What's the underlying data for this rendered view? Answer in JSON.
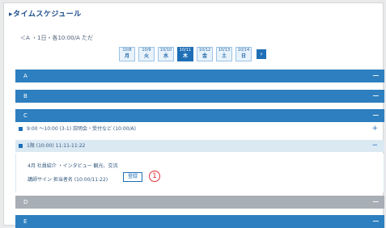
{
  "page": {
    "title": "▸タイムスケジュール",
    "subtitle": "＜A ・1日・各10:00/A ただ"
  },
  "days": [
    {
      "label": "10/8",
      "num": "月"
    },
    {
      "label": "10/9",
      "num": "火"
    },
    {
      "label": "10/10",
      "num": "水"
    },
    {
      "label": "10/11",
      "num": "木"
    },
    {
      "label": "10/12",
      "num": "金"
    },
    {
      "label": "10/13",
      "num": "土"
    },
    {
      "label": "10/14",
      "num": "日"
    }
  ],
  "nav": {
    "next": "›"
  },
  "sections": [
    {
      "label": "A",
      "sign": "−"
    },
    {
      "label": "B",
      "sign": "−"
    },
    {
      "label": "C",
      "sign": "−"
    }
  ],
  "items": [
    {
      "text": "9:00 〜10:00 (3-1) 説明会・受付など (10:00/A)",
      "sign": "+"
    },
    {
      "text": "1限 (10:00) 11:11-11:22",
      "sign": "−"
    }
  ],
  "detail": {
    "line1": "4月 社員紹介 ・インタビュー 観光、交流",
    "line2": "講師サイン 担当者名 (10:00/11:22)",
    "button_label": "登録",
    "marker": "1"
  },
  "sections_after": [
    {
      "label": "D",
      "sign": "−"
    },
    {
      "label": "E",
      "sign": "−"
    }
  ],
  "colors": {
    "accent": "#2d7fbf",
    "marker": "#e0333a"
  }
}
